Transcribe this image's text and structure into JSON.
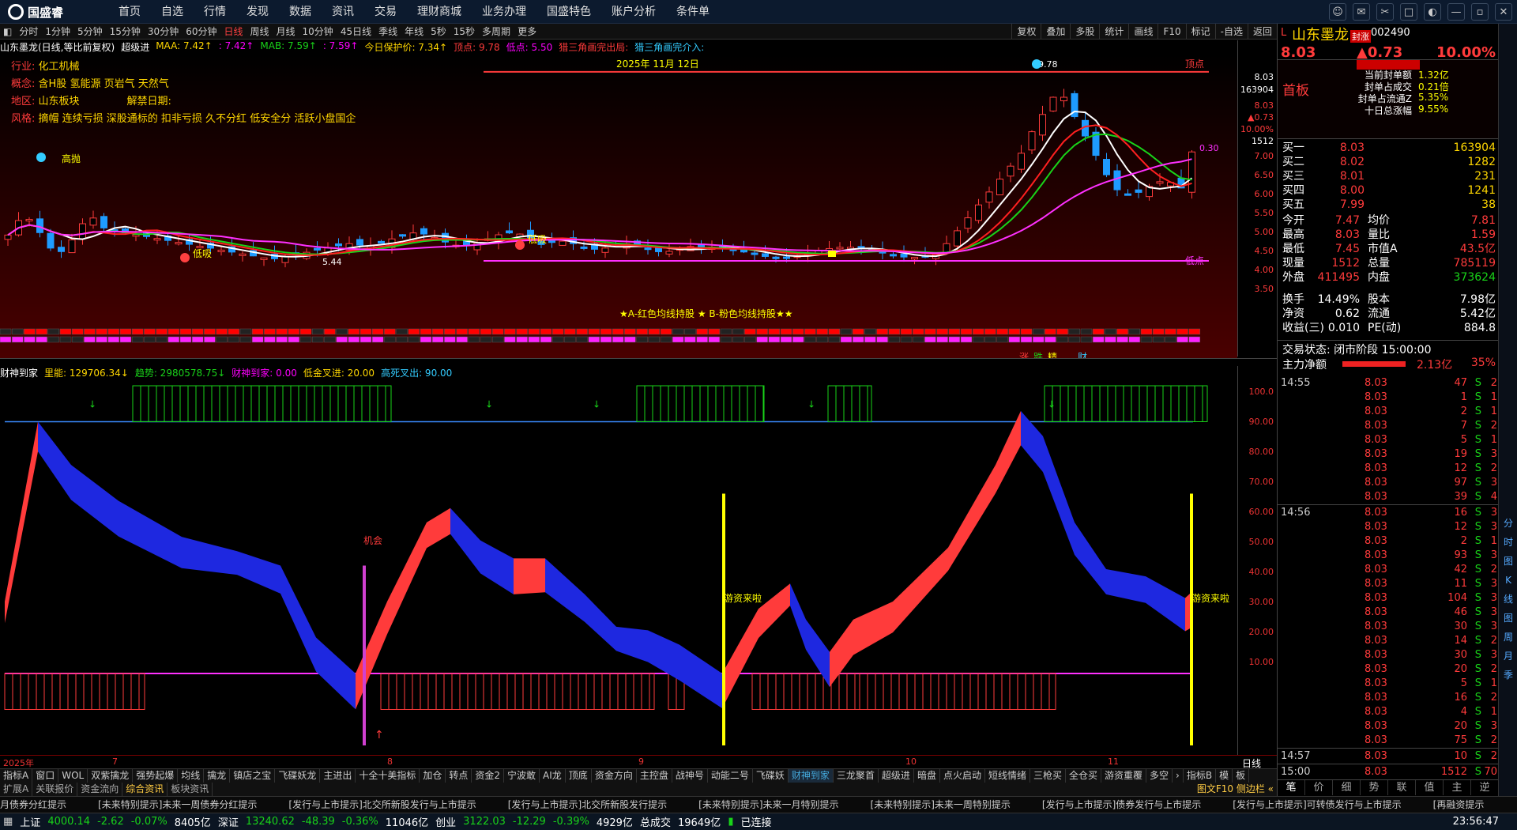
{
  "app": {
    "name": "国盛睿"
  },
  "menu": [
    "首页",
    "自选",
    "行情",
    "发现",
    "数据",
    "资讯",
    "交易",
    "理财商城",
    "业务办理",
    "国盛特色",
    "账户分析",
    "条件单"
  ],
  "timeframes": [
    "分时",
    "1分钟",
    "5分钟",
    "15分钟",
    "30分钟",
    "60分钟",
    "日线",
    "周线",
    "月线",
    "10分钟",
    "45日线",
    "季线",
    "年线",
    "5秒",
    "15秒",
    "多周期",
    "更多"
  ],
  "active_tf": "日线",
  "tf_right": [
    "复权",
    "叠加",
    "多股",
    "统计",
    "画线",
    "F10",
    "标记",
    "-自选",
    "返回"
  ],
  "ind_bar1": {
    "stock": "山东墨龙(日线,等比前复权)",
    "name": "超级进",
    "maa": "MAA: 7.42↑",
    "maa2": ": 7.42↑",
    "mab": "MAB: 7.59↑",
    "mab2": ": 7.59↑",
    "protect": "今日保护价: 7.34↑",
    "top": "顶点: 9.78",
    "bottom": "低点: 5.50",
    "tri1": "猎三角画完出局:",
    "tri2": "猎三角画完介入:"
  },
  "info": {
    "industry_label": "行业:",
    "industry": "化工机械",
    "concept_label": "概念:",
    "concept": "含H股 氢能源 页岩气 天然气",
    "region_label": "地区:",
    "region": "山东板块",
    "unlock_label": "解禁日期:",
    "style_label": "风格:",
    "style": "摘帽 连续亏损 深股通标的 扣非亏损 久不分红 低安全分 活跃小盘国企"
  },
  "chart_labels": {
    "date": "2025年 11月 12日",
    "gaopao": "高抛",
    "dixi1": "低吸",
    "dixi2": "低吸",
    "low_val": "5.44",
    "peak": "9.78",
    "top_line": "顶点",
    "bottom_line": "低点",
    "pct_label": "0.30",
    "legend": "★A-红色均线持股 ★ B-粉色均线持股★★",
    "bottom_tags": [
      "涨",
      "跌",
      "精",
      "财"
    ]
  },
  "kaxis": [
    "8.03",
    "163904",
    "8.03",
    "▲0.73",
    "10.00%",
    "1512",
    "7.00",
    "6.50",
    "6.00",
    "5.50",
    "5.00",
    "4.50",
    "4.00",
    "3.50"
  ],
  "ind_bar2": {
    "name": "财神到家",
    "a": "里能: 129706.34↓",
    "b": "趋势: 2980578.75↓",
    "c": "财神到家: 0.00",
    "d": "低金叉进: 20.00",
    "e": "高死叉出: 90.00"
  },
  "ind_labels": {
    "jihui": "机会",
    "youzi1": "游资来啦",
    "youzi2": "游资来啦"
  },
  "iaxis": [
    "100.0",
    "90.00",
    "80.00",
    "70.00",
    "60.00",
    "50.00",
    "40.00",
    "30.00",
    "20.00",
    "10.00"
  ],
  "dates": {
    "year": "2025年",
    "m7": "7",
    "m8": "8",
    "m9": "9",
    "m10": "10",
    "m11": "11",
    "period": "日线"
  },
  "tabs1": [
    "指标A",
    "窗口",
    "WOL",
    "双紫擒龙",
    "强势起爆",
    "均线",
    "擒龙",
    "镇店之宝",
    "飞碟妖龙",
    "主进出",
    "十全十美指标",
    "加仓",
    "转点",
    "资金2",
    "宁波敢",
    "AI龙",
    "顶底",
    "资金方向",
    "主控盘",
    "战神号",
    "动能二号",
    "飞碟妖",
    "财神到家",
    "三龙聚首",
    "超级进",
    "暗盘",
    "点火启动",
    "短线情绪",
    "三枪买",
    "全仓买",
    "游资重覆",
    "多空",
    "›",
    "指标B",
    "模",
    "板"
  ],
  "active_tab1": "财神到家",
  "tabs2": [
    "扩展A",
    "关联报价",
    "资金流向",
    "综合资讯",
    "板块资讯"
  ],
  "active_tab2": "综合资讯",
  "tabs2_right": "图文F10 侧边栏 «",
  "ticker": [
    "月债券分红提示",
    "[未来特别提示]未来一周债券分红提示",
    "[发行与上市提示]北交所新股发行与上市提示",
    "[发行与上市提示]北交所新股发行提示",
    "[未来特别提示]未来一月特别提示",
    "[未来特别提示]未来一周特别提示",
    "[发行与上市提示]债券发行与上市提示",
    "[发行与上市提示]可转债发行与上市提示",
    "[再融资提示"
  ],
  "status": {
    "sh": "上证",
    "sh_v": "4000.14",
    "sh_c": "-2.62",
    "sh_p": "-0.07%",
    "sh_a": "8405亿",
    "sz": "深证",
    "sz_v": "13240.62",
    "sz_c": "-48.39",
    "sz_p": "-0.36%",
    "sz_a": "11046亿",
    "cy": "创业",
    "cy_v": "3122.03",
    "cy_c": "-12.29",
    "cy_p": "-0.39%",
    "cy_a": "4929亿",
    "tot_l": "总成交",
    "tot": "19649亿",
    "conn": "已连接",
    "time": "23:56:47"
  },
  "right": {
    "flag": "L",
    "name": "山东墨龙",
    "badge": "封涨",
    "code": "002490",
    "price": "8.03",
    "chg": "▲0.73",
    "pct": "10.00%",
    "board": "首板",
    "seal": [
      {
        "l": "当前封单额",
        "v": "1.32亿"
      },
      {
        "l": "封单占成交",
        "v": "0.21倍"
      },
      {
        "l": "封单占流通Z",
        "v": "5.35%"
      },
      {
        "l": "十日总涨幅",
        "v": "9.55%"
      }
    ],
    "sell": [
      [
        "卖一",
        "",
        ""
      ],
      [
        "卖二",
        "",
        ""
      ],
      [
        "卖三",
        "",
        ""
      ],
      [
        "卖四",
        "",
        ""
      ],
      [
        "卖五",
        "",
        ""
      ]
    ],
    "buy": [
      [
        "买一",
        "8.03",
        "163904"
      ],
      [
        "买二",
        "8.02",
        "1282"
      ],
      [
        "买三",
        "8.01",
        "231"
      ],
      [
        "买四",
        "8.00",
        "1241"
      ],
      [
        "买五",
        "7.99",
        "38"
      ]
    ],
    "stats": [
      [
        "今开",
        "7.47",
        "均价",
        "7.81"
      ],
      [
        "最高",
        "8.03",
        "量比",
        "1.59"
      ],
      [
        "最低",
        "7.45",
        "市值A",
        "43.5亿"
      ],
      [
        "现量",
        "1512",
        "总量",
        "785119"
      ],
      [
        "外盘",
        "411495",
        "内盘",
        "373624"
      ]
    ],
    "stats2": [
      [
        "换手",
        "14.49%",
        "股本",
        "7.98亿"
      ],
      [
        "净资",
        "0.62",
        "流通",
        "5.42亿"
      ],
      [
        "收益(三)",
        "0.010",
        "PE(动)",
        "884.8"
      ]
    ],
    "trade_state": "交易状态: 闭市阶段 15:00:00",
    "main_flow": "主力净额",
    "main_flow_v": "2.13亿",
    "main_flow_p": "35%",
    "ticks": [
      [
        "14:55",
        "8.03",
        "47",
        "S",
        "2"
      ],
      [
        "",
        "8.03",
        "1",
        "S",
        "1"
      ],
      [
        "",
        "8.03",
        "2",
        "S",
        "1"
      ],
      [
        "",
        "8.03",
        "7",
        "S",
        "2"
      ],
      [
        "",
        "8.03",
        "5",
        "S",
        "1"
      ],
      [
        "",
        "8.03",
        "19",
        "S",
        "3"
      ],
      [
        "",
        "8.03",
        "12",
        "S",
        "2"
      ],
      [
        "",
        "8.03",
        "97",
        "S",
        "3"
      ],
      [
        "",
        "8.03",
        "39",
        "S",
        "4"
      ],
      [
        "14:56",
        "8.03",
        "16",
        "S",
        "3"
      ],
      [
        "",
        "8.03",
        "12",
        "S",
        "3"
      ],
      [
        "",
        "8.03",
        "2",
        "S",
        "1"
      ],
      [
        "",
        "8.03",
        "93",
        "S",
        "3"
      ],
      [
        "",
        "8.03",
        "42",
        "S",
        "2"
      ],
      [
        "",
        "8.03",
        "11",
        "S",
        "3"
      ],
      [
        "",
        "8.03",
        "104",
        "S",
        "3"
      ],
      [
        "",
        "8.03",
        "46",
        "S",
        "3"
      ],
      [
        "",
        "8.03",
        "30",
        "S",
        "3"
      ],
      [
        "",
        "8.03",
        "14",
        "S",
        "2"
      ],
      [
        "",
        "8.03",
        "30",
        "S",
        "3"
      ],
      [
        "",
        "8.03",
        "20",
        "S",
        "2"
      ],
      [
        "",
        "8.03",
        "5",
        "S",
        "1"
      ],
      [
        "",
        "8.03",
        "16",
        "S",
        "2"
      ],
      [
        "",
        "8.03",
        "4",
        "S",
        "1"
      ],
      [
        "",
        "8.03",
        "20",
        "S",
        "3"
      ],
      [
        "",
        "8.03",
        "75",
        "S",
        "2"
      ],
      [
        "14:57",
        "8.03",
        "10",
        "S",
        "2"
      ],
      [
        "15:00",
        "8.03",
        "1512",
        "S",
        "70"
      ]
    ],
    "btabs": [
      "笔",
      "价",
      "细",
      "势",
      "联",
      "值",
      "主",
      "逆"
    ]
  },
  "side_icons": [
    "分",
    "时",
    "图",
    "K",
    "线",
    "图",
    "周",
    "月",
    "季"
  ],
  "chart_data": {
    "type": "candlestick",
    "series_name": "山东墨龙 日线",
    "ma_lines": [
      "MAA",
      "MAB"
    ],
    "ylim": [
      3.5,
      10.2
    ],
    "high": 9.78,
    "low": 5.44,
    "last": 8.03,
    "bottom_line": 5.5
  },
  "colors": {
    "up": "#ff3b3b",
    "down": "#1e9bff",
    "bg": "#000000",
    "accent": "#ff3b3b",
    "chart_bg": "#4a0000"
  }
}
